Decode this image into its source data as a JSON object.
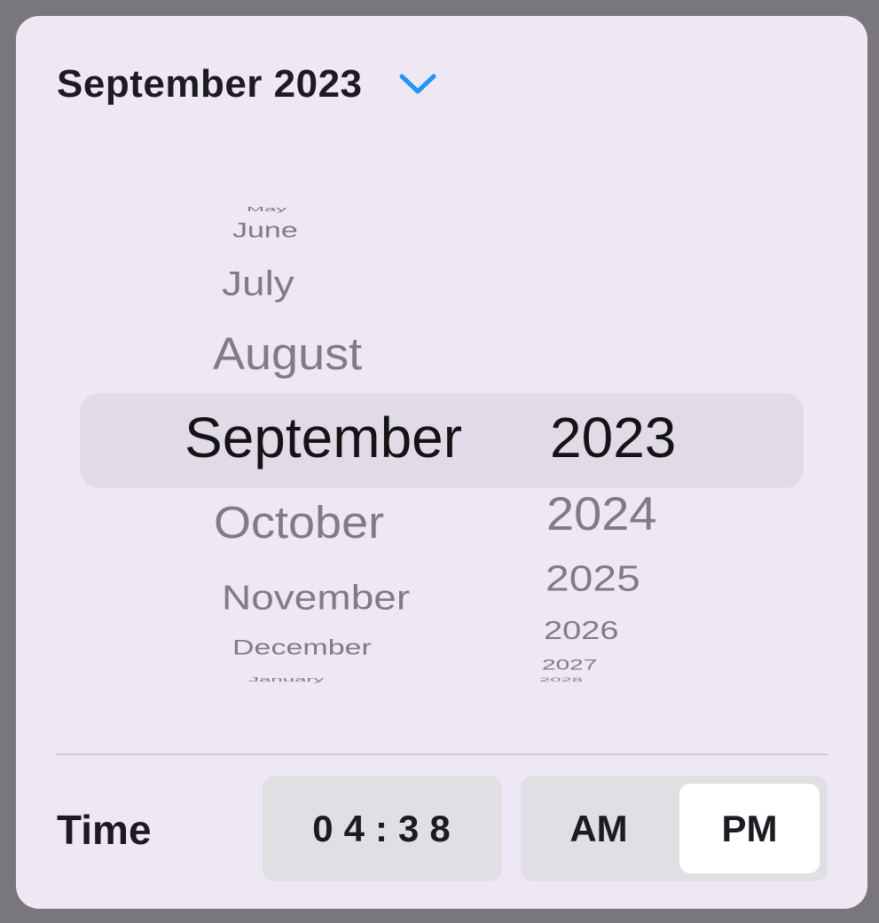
{
  "header": {
    "title": "September 2023"
  },
  "picker": {
    "months": [
      "May",
      "June",
      "July",
      "August",
      "September",
      "October",
      "November",
      "December",
      "January"
    ],
    "years": [
      "2023",
      "2024",
      "2025",
      "2026",
      "2027",
      "2028"
    ],
    "selected_month": "September",
    "selected_year": "2023"
  },
  "time": {
    "label": "Time",
    "value": "04:38",
    "am_label": "AM",
    "pm_label": "PM",
    "selected_period": "PM"
  },
  "colors": {
    "accent": "#2196f3",
    "card_background": "#ede8f4",
    "selection_highlight": "#e0dbe6"
  }
}
